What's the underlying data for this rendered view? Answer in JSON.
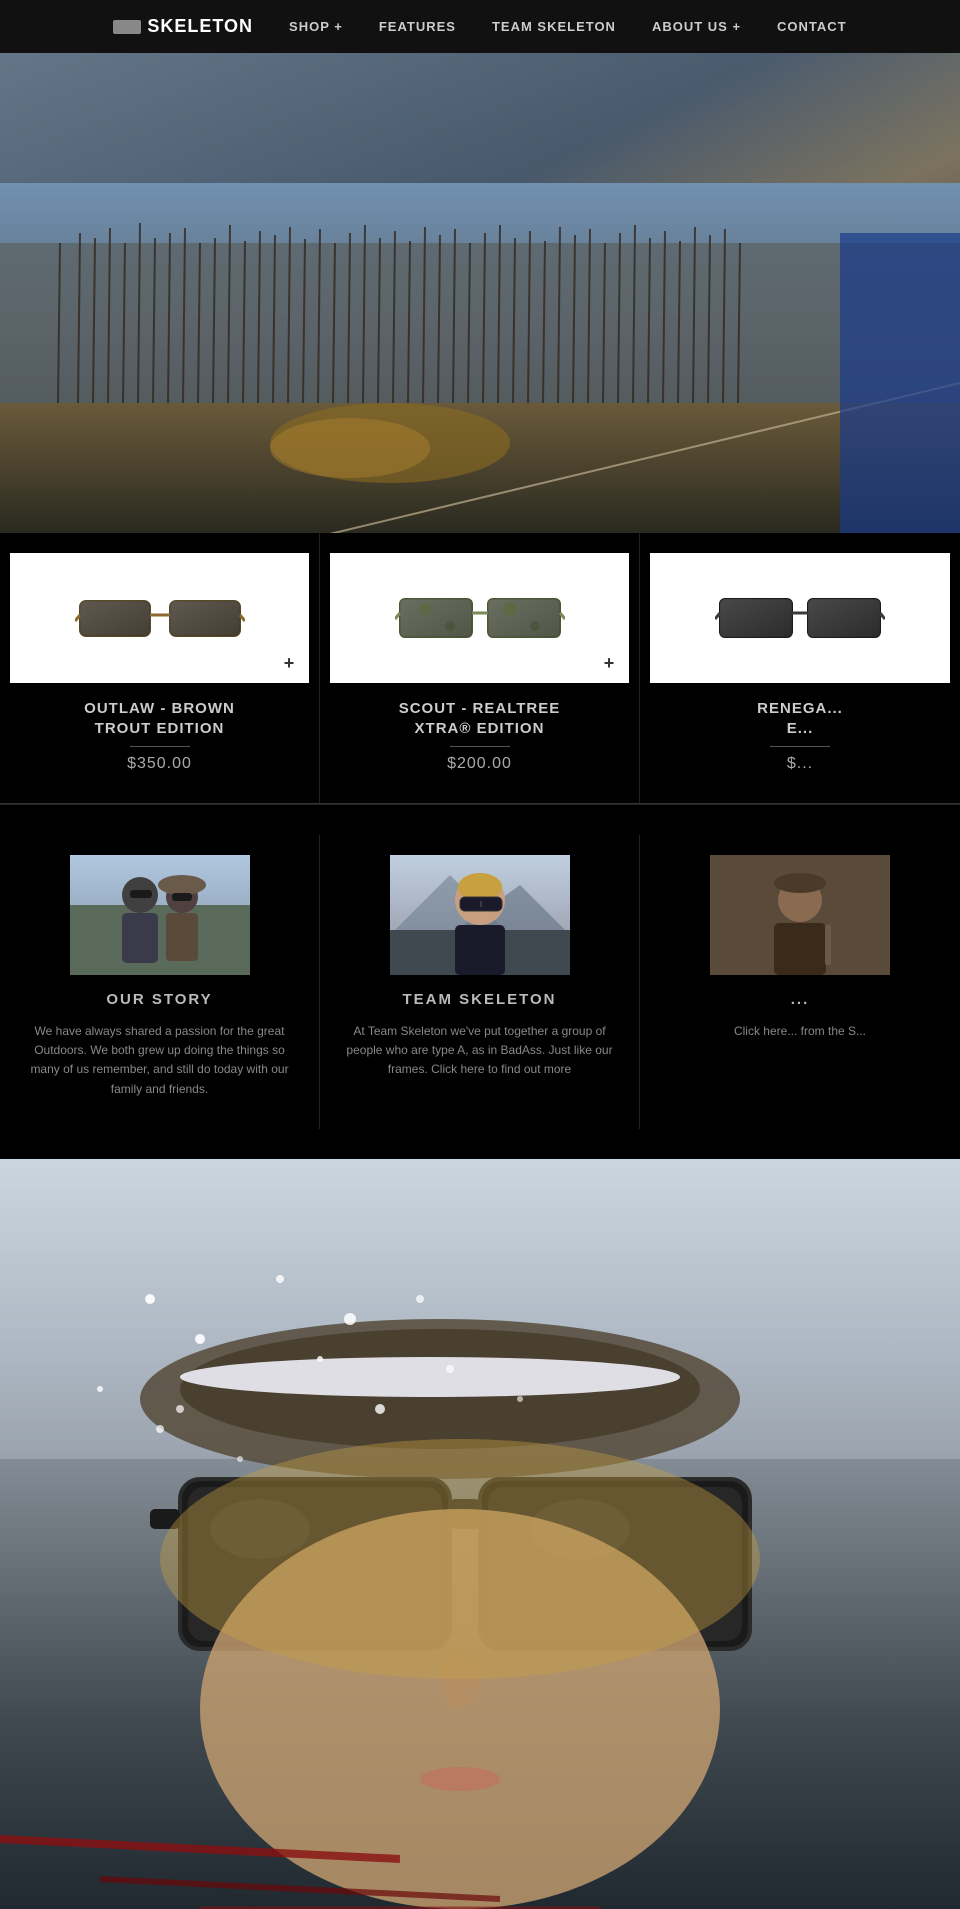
{
  "nav": {
    "logo_text": "SKELETON",
    "links": [
      {
        "id": "shop",
        "label": "SHOP +"
      },
      {
        "id": "features",
        "label": "FEATURES"
      },
      {
        "id": "team",
        "label": "TEAM SKELETON"
      },
      {
        "id": "about",
        "label": "ABOUT US +"
      },
      {
        "id": "contact",
        "label": "CONTACT"
      }
    ]
  },
  "products": [
    {
      "id": "outlaw",
      "name": "OUTLAW - BROWN\nTROUT EDITION",
      "price": "$350.00",
      "name_line1": "OUTLAW - BROWN",
      "name_line2": "TROUT EDITION"
    },
    {
      "id": "scout",
      "name": "SCOUT - REALTREE\nXTRA® EDITION",
      "price": "$200.00",
      "name_line1": "SCOUT - REALTREE",
      "name_line2": "XTRA® EDITION"
    },
    {
      "id": "renega",
      "name": "RENEGA...\nE...",
      "price": "$...",
      "name_line1": "RENEGA...",
      "name_line2": "E..."
    }
  ],
  "stories": [
    {
      "id": "our-story",
      "title": "OUR STORY",
      "text": "We have always shared a passion for the great Outdoors. We both grew up doing the things so many of us remember, and still do today with our family and friends."
    },
    {
      "id": "team-skeleton",
      "title": "TEAM SKELETON",
      "text": "At Team Skeleton we've put together a group of people who are type A, as in BadAss. Just like our frames. Click here to find out more"
    },
    {
      "id": "extra",
      "title": "...",
      "text": "Click here... from the S..."
    }
  ]
}
